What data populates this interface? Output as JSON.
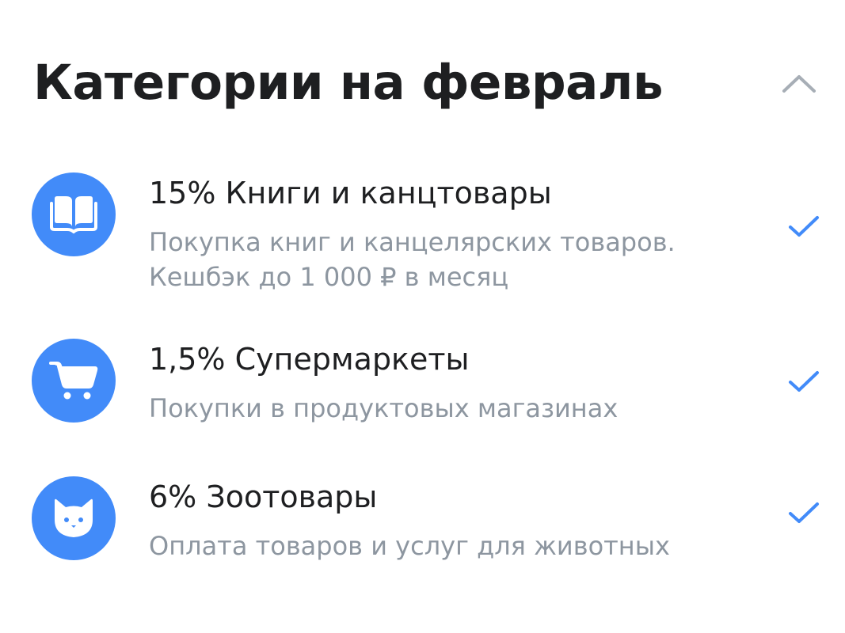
{
  "header": {
    "title": "Категории на февраль",
    "collapse_icon": "chevron-up-icon"
  },
  "colors": {
    "accent": "#428bf9",
    "title_text": "#1e1f21",
    "secondary_text": "#8d96a0",
    "chevron": "#a7aeb6"
  },
  "categories": [
    {
      "title": "15% Книги и канцтовары",
      "description_lines": [
        "Покупка книг и канцелярских товаров.",
        "Кешбэк до 1 000 ₽ в месяц"
      ],
      "icon": "book-icon",
      "selected": true
    },
    {
      "title": "1,5% Супермаркеты",
      "description_lines": [
        "Покупки в продуктовых магазинах"
      ],
      "icon": "shopping-cart-icon",
      "selected": true
    },
    {
      "title": "6% Зоотовары",
      "description_lines": [
        "Оплата товаров и услуг для животных"
      ],
      "icon": "cat-icon",
      "selected": true
    }
  ]
}
